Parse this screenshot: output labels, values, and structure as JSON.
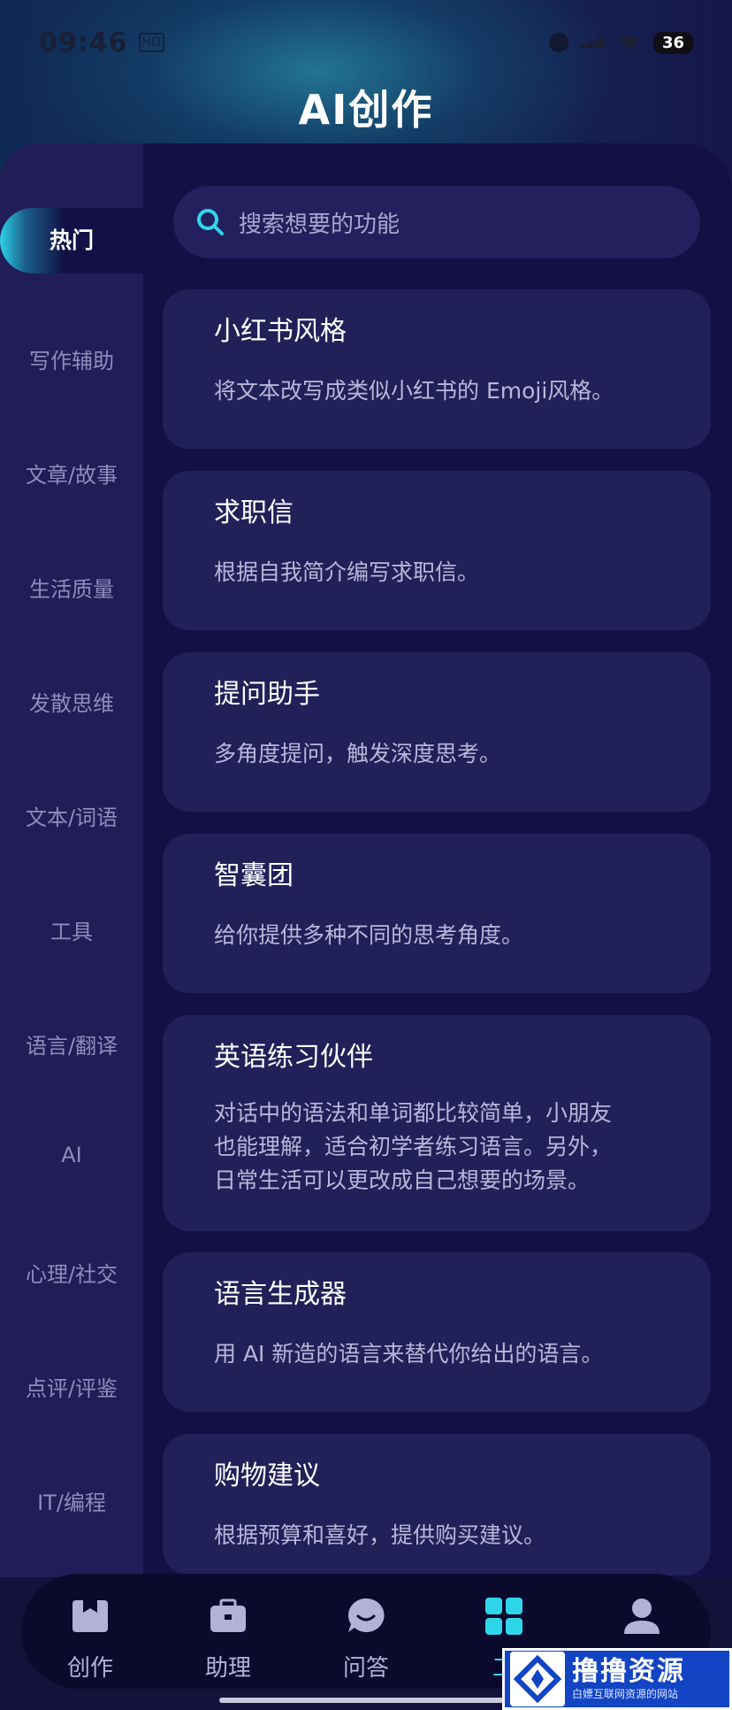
{
  "status_bar": {
    "time": "09:46",
    "battery": "36"
  },
  "header": {
    "title": "AI创作"
  },
  "search": {
    "placeholder": "搜索想要的功能"
  },
  "sidebar": {
    "items": [
      {
        "label": "热门",
        "active": true
      },
      {
        "label": "写作辅助"
      },
      {
        "label": "文章/故事"
      },
      {
        "label": "生活质量"
      },
      {
        "label": "发散思维"
      },
      {
        "label": "文本/词语"
      },
      {
        "label": "工具"
      },
      {
        "label": "语言/翻译"
      },
      {
        "label": "AI"
      },
      {
        "label": "心理/社交"
      },
      {
        "label": "点评/评鉴"
      },
      {
        "label": "IT/编程"
      }
    ]
  },
  "cards": [
    {
      "title": "小红书风格",
      "desc": "将文本改写成类似小红书的 Emoji风格。"
    },
    {
      "title": "求职信",
      "desc": "根据自我简介编写求职信。"
    },
    {
      "title": "提问助手",
      "desc": "多角度提问，触发深度思考。"
    },
    {
      "title": "智囊团",
      "desc": "给你提供多种不同的思考角度。"
    },
    {
      "title": "英语练习伙伴",
      "desc_lines": [
        "对话中的语法和单词都比较简单，小朋友",
        "也能理解，适合初学者练习语言。另外，",
        "日常生活可以更改成自己想要的场景。"
      ]
    },
    {
      "title": "语言生成器",
      "desc": "用 AI 新造的语言来替代你给出的语言。"
    },
    {
      "title": "购物建议",
      "desc": "根据预算和喜好，提供购买建议。"
    }
  ],
  "bottom_nav": {
    "items": [
      {
        "label": "创作",
        "icon": "inbox-box-icon"
      },
      {
        "label": "助理",
        "icon": "briefcase-icon"
      },
      {
        "label": "问答",
        "icon": "chat-bubble-icon"
      },
      {
        "label": "工",
        "icon": "grid-icon",
        "active": true
      },
      {
        "label": "",
        "icon": "user-icon"
      }
    ]
  },
  "watermark": {
    "main": "撸撸资源",
    "sub": "白嫖互联网资源的网站"
  },
  "colors": {
    "accent": "#2fd6ea",
    "background": "#121045",
    "card": "#222059",
    "sidebar": "#201d58"
  }
}
